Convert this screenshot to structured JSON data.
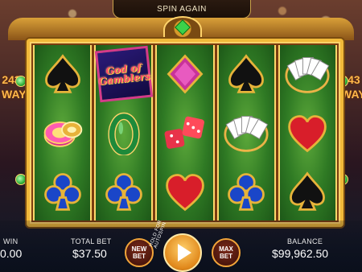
{
  "banner": {
    "text": "SPIN AGAIN"
  },
  "ways": {
    "number": "243",
    "word": "WAYS"
  },
  "logo": {
    "line1": "God of",
    "line2": "Gamblers"
  },
  "reels": [
    [
      "spade-icon",
      "chips-icon",
      "club-icon"
    ],
    [
      "god-of-gamblers-logo",
      "jade-bangle-icon",
      "club-icon"
    ],
    [
      "diamond-icon",
      "dice-icon",
      "heart-icon"
    ],
    [
      "spade-icon",
      "playing-cards-icon",
      "club-icon"
    ],
    [
      "playing-cards-icon",
      "heart-icon",
      "spade-icon"
    ]
  ],
  "footer": {
    "win_label": "WIN",
    "win_value": "0.00",
    "total_bet_label": "TOTAL BET",
    "total_bet_value": "$37.50",
    "new_bet_line1": "NEW",
    "new_bet_line2": "BET",
    "hold_label": "HOLD FOR AUTOSPIN",
    "max_bet_line1": "MAX",
    "max_bet_line2": "BET",
    "balance_label": "BALANCE",
    "balance_value": "$99,962.50"
  },
  "colors": {
    "frame_gold": "#f1b93a",
    "felt_green": "#2f7a24",
    "ways_orange": "#ffb84a",
    "spin_orange": "#e0871a"
  }
}
